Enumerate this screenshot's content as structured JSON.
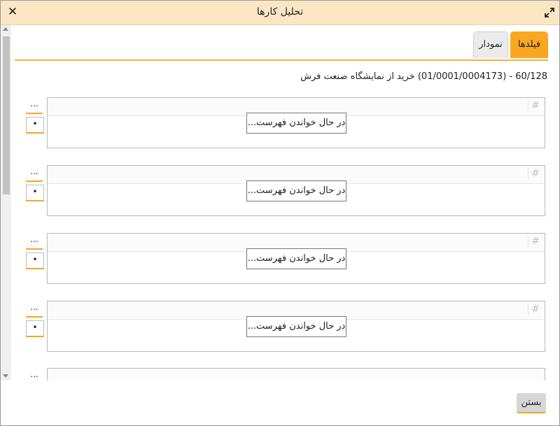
{
  "window": {
    "title": "تحلیل کارها"
  },
  "tabs": [
    {
      "label": "فیلدها",
      "active": true
    },
    {
      "label": "نمودار",
      "active": false
    }
  ],
  "info_line": "60/128 - (01/0001/0004173) خرید از نمایشگاه صنعت فرش",
  "lists": [
    {
      "button_more": "...",
      "button_dot": "•",
      "header_symbol": "#",
      "loading_text": "در حال خواندن فهرست..."
    },
    {
      "button_more": "...",
      "button_dot": "•",
      "header_symbol": "#",
      "loading_text": "در حال خواندن فهرست..."
    },
    {
      "button_more": "...",
      "button_dot": "•",
      "header_symbol": "#",
      "loading_text": "در حال خواندن فهرست..."
    },
    {
      "button_more": "...",
      "button_dot": "•",
      "header_symbol": "#",
      "loading_text": "در حال خواندن فهرست..."
    },
    {
      "button_more": "..."
    }
  ],
  "footer": {
    "close_label": "بستن"
  },
  "colors": {
    "accent": "#f9a720",
    "titlebar": "#fbe6c4"
  },
  "icons": {
    "close": "close-icon",
    "maximize": "maximize-icon"
  }
}
